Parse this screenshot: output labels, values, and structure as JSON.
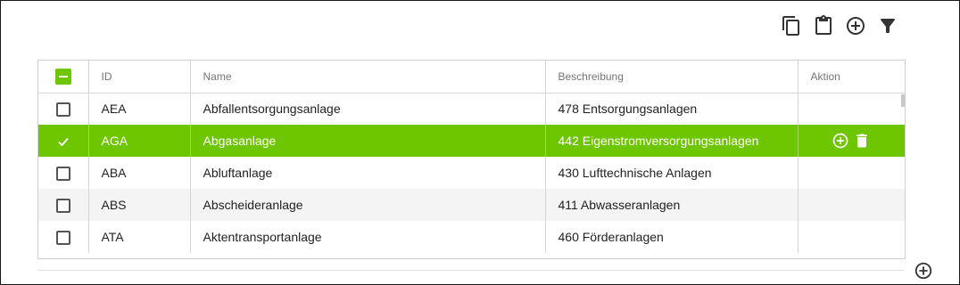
{
  "toolbar": {
    "icons": [
      "copy-icon",
      "paste-icon",
      "add-circle-icon",
      "filter-icon"
    ]
  },
  "table": {
    "headers": {
      "id": "ID",
      "name": "Name",
      "description": "Beschreibung",
      "action": "Aktion"
    },
    "rows": [
      {
        "id": "AEA",
        "name": "Abfallentsorgungsanlage",
        "description": "478 Entsorgungsanlagen",
        "selected": false
      },
      {
        "id": "AGA",
        "name": "Abgasanlage",
        "description": "442 Eigenstromversorgungsanlagen",
        "selected": true
      },
      {
        "id": "ABA",
        "name": "Abluftanlage",
        "description": "430 Lufttechnische Anlagen",
        "selected": false
      },
      {
        "id": "ABS",
        "name": "Abscheideranlage",
        "description": "411 Abwasseranlagen",
        "selected": false
      },
      {
        "id": "ATA",
        "name": "Aktentransportanlage",
        "description": "460 Förderanlagen",
        "selected": false
      }
    ]
  },
  "colors": {
    "accent": "#6ec600",
    "row_alt": "#f4f4f4",
    "border": "#d7d7d7"
  }
}
